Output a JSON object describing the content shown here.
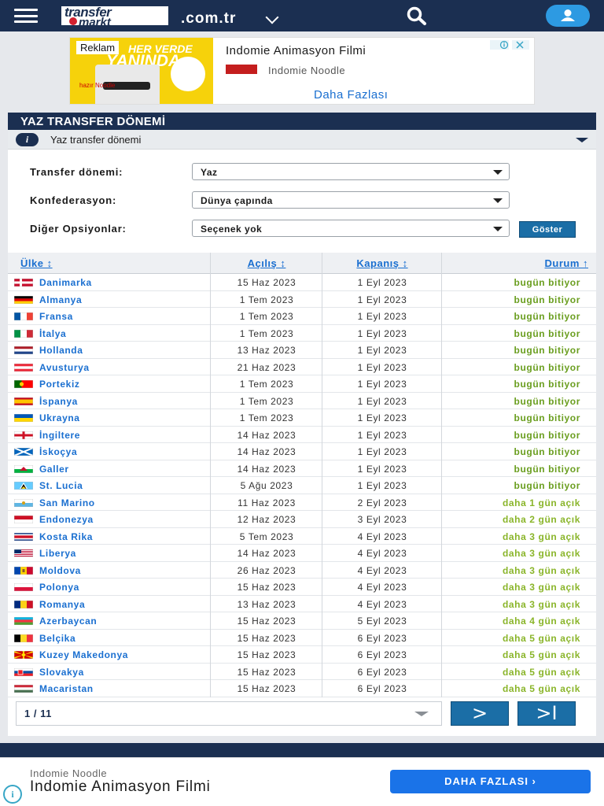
{
  "header": {
    "domain": ".com.tr",
    "logo_line1": "transfer",
    "logo_line2": "markt"
  },
  "top_ad": {
    "badge": "Reklam",
    "headline": "Indomie Animasyon Filmi",
    "advertiser": "Indomie Noodle",
    "cta": "Daha Fazlası",
    "image_text_1": "HER VERDE",
    "image_text_2": "YANINDA",
    "image_text_3": "hazır Noodle"
  },
  "panel": {
    "title": "YAZ TRANSFER DÖNEMİ",
    "subtitle": "Yaz transfer dönemi"
  },
  "filters": {
    "period_label": "Transfer dönemi:",
    "period_value": "Yaz",
    "confed_label": "Konfederasyon:",
    "confed_value": "Dünya çapında",
    "options_label": "Diğer Opsiyonlar:",
    "options_value": "Seçenek yok",
    "submit": "Göster"
  },
  "table": {
    "columns": [
      "Ülke ↕",
      "Açılış ↕",
      "Kapanış ↕",
      "Durum ↑"
    ],
    "rows": [
      {
        "country": "Danimarka",
        "open": "15 Haz 2023",
        "close": "1 Eyl 2023",
        "status": "bugün bitiyor",
        "flag": "dk"
      },
      {
        "country": "Almanya",
        "open": "1 Tem 2023",
        "close": "1 Eyl 2023",
        "status": "bugün bitiyor",
        "flag": "de"
      },
      {
        "country": "Fransa",
        "open": "1 Tem 2023",
        "close": "1 Eyl 2023",
        "status": "bugün bitiyor",
        "flag": "fr"
      },
      {
        "country": "İtalya",
        "open": "1 Tem 2023",
        "close": "1 Eyl 2023",
        "status": "bugün bitiyor",
        "flag": "it"
      },
      {
        "country": "Hollanda",
        "open": "13 Haz 2023",
        "close": "1 Eyl 2023",
        "status": "bugün bitiyor",
        "flag": "nl"
      },
      {
        "country": "Avusturya",
        "open": "21 Haz 2023",
        "close": "1 Eyl 2023",
        "status": "bugün bitiyor",
        "flag": "at"
      },
      {
        "country": "Portekiz",
        "open": "1 Tem 2023",
        "close": "1 Eyl 2023",
        "status": "bugün bitiyor",
        "flag": "pt"
      },
      {
        "country": "İspanya",
        "open": "1 Tem 2023",
        "close": "1 Eyl 2023",
        "status": "bugün bitiyor",
        "flag": "es"
      },
      {
        "country": "Ukrayna",
        "open": "1 Tem 2023",
        "close": "1 Eyl 2023",
        "status": "bugün bitiyor",
        "flag": "ua"
      },
      {
        "country": "İngiltere",
        "open": "14 Haz 2023",
        "close": "1 Eyl 2023",
        "status": "bugün bitiyor",
        "flag": "en"
      },
      {
        "country": "İskoçya",
        "open": "14 Haz 2023",
        "close": "1 Eyl 2023",
        "status": "bugün bitiyor",
        "flag": "sc"
      },
      {
        "country": "Galler",
        "open": "14 Haz 2023",
        "close": "1 Eyl 2023",
        "status": "bugün bitiyor",
        "flag": "wa"
      },
      {
        "country": "St. Lucia",
        "open": "5 Ağu 2023",
        "close": "1 Eyl 2023",
        "status": "bugün bitiyor",
        "flag": "lc"
      },
      {
        "country": "San Marino",
        "open": "11 Haz 2023",
        "close": "2 Eyl 2023",
        "status": "daha 1 gün açık",
        "flag": "sm"
      },
      {
        "country": "Endonezya",
        "open": "12 Haz 2023",
        "close": "3 Eyl 2023",
        "status": "daha 2 gün açık",
        "flag": "id"
      },
      {
        "country": "Kosta Rika",
        "open": "5 Tem 2023",
        "close": "4 Eyl 2023",
        "status": "daha 3 gün açık",
        "flag": "cr"
      },
      {
        "country": "Liberya",
        "open": "14 Haz 2023",
        "close": "4 Eyl 2023",
        "status": "daha 3 gün açık",
        "flag": "lr"
      },
      {
        "country": "Moldova",
        "open": "26 Haz 2023",
        "close": "4 Eyl 2023",
        "status": "daha 3 gün açık",
        "flag": "md"
      },
      {
        "country": "Polonya",
        "open": "15 Haz 2023",
        "close": "4 Eyl 2023",
        "status": "daha 3 gün açık",
        "flag": "pl"
      },
      {
        "country": "Romanya",
        "open": "13 Haz 2023",
        "close": "4 Eyl 2023",
        "status": "daha 3 gün açık",
        "flag": "ro"
      },
      {
        "country": "Azerbaycan",
        "open": "15 Haz 2023",
        "close": "5 Eyl 2023",
        "status": "daha 4 gün açık",
        "flag": "az"
      },
      {
        "country": "Belçika",
        "open": "15 Haz 2023",
        "close": "6 Eyl 2023",
        "status": "daha 5 gün açık",
        "flag": "be"
      },
      {
        "country": "Kuzey Makedonya",
        "open": "15 Haz 2023",
        "close": "6 Eyl 2023",
        "status": "daha 5 gün açık",
        "flag": "mk"
      },
      {
        "country": "Slovakya",
        "open": "15 Haz 2023",
        "close": "6 Eyl 2023",
        "status": "daha 5 gün açık",
        "flag": "sk"
      },
      {
        "country": "Macaristan",
        "open": "15 Haz 2023",
        "close": "6 Eyl 2023",
        "status": "daha 5 gün açık",
        "flag": "hu"
      }
    ]
  },
  "pagination": {
    "current": "1 / 11",
    "next": ">",
    "last": ">I"
  },
  "bottom_ad": {
    "advertiser": "Indomie Noodle",
    "headline": "Indomie Animasyon Filmi",
    "cta": "DAHA FAZLASI  ›"
  },
  "colors": {
    "navy": "#1b2f51",
    "link_blue": "#1a6fd0",
    "status_today": "#6a9e1f",
    "status_open": "#8ab52a",
    "button_blue": "#1b6ea6"
  },
  "icons": {
    "menu": "hamburger-icon",
    "search": "search-icon",
    "user": "user-icon",
    "info": "info-icon",
    "dropdown": "chevron-down-icon"
  }
}
